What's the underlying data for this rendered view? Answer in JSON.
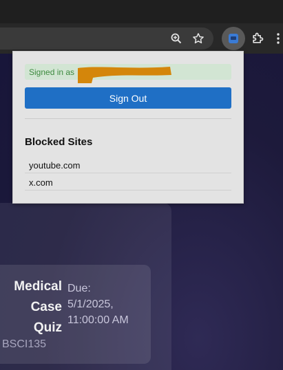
{
  "toolbar": {
    "icons": [
      "zoom-icon",
      "star-icon",
      "extension-icon",
      "puzzle-icon",
      "menu-icon"
    ]
  },
  "popup": {
    "signed_in_label": "Signed in as",
    "sign_out_label": "Sign Out",
    "blocked_title": "Blocked Sites",
    "blocked_sites": [
      "youtube.com",
      "x.com"
    ],
    "colors": {
      "button": "#1f6fc5",
      "signed_bg": "#d2e5d3",
      "signed_text": "#3d8a3f",
      "redaction": "#d4860b"
    }
  },
  "page": {
    "course_title": "Medical\nCase\nQuiz",
    "course_code": "BSCI135",
    "due": "Due:\n5/1/2025,\n11:00:00 AM"
  }
}
